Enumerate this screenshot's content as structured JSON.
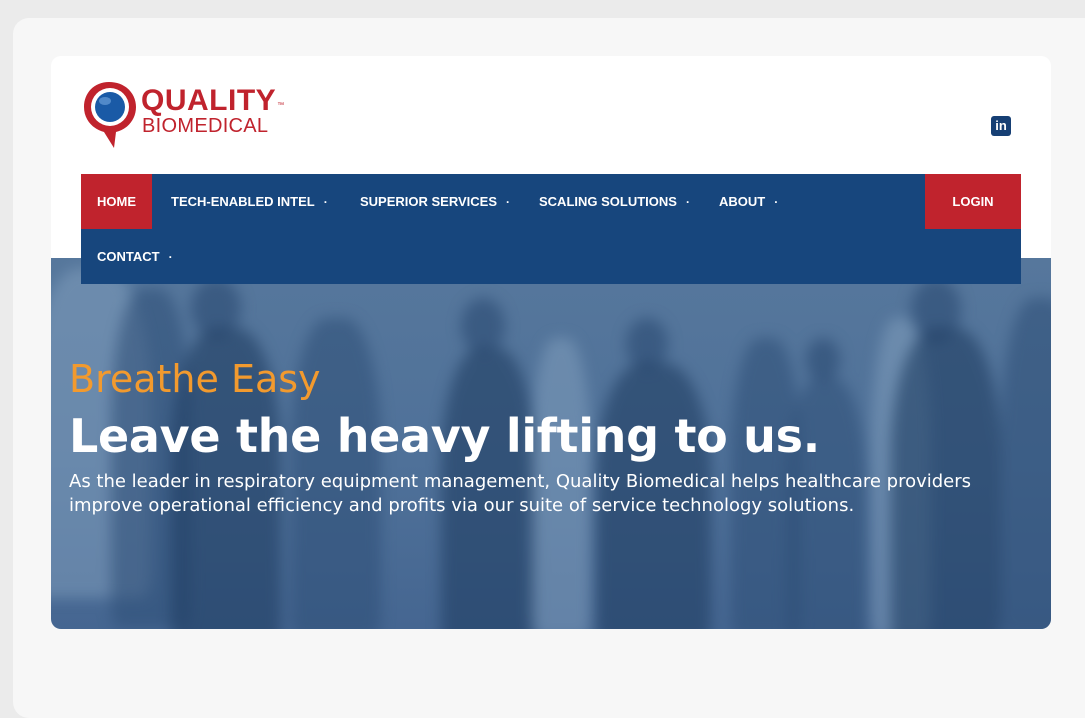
{
  "brand": {
    "name_line1": "QUALITY",
    "name_line2": "BIOMEDICAL",
    "trademark": "™",
    "logo_red": "#c0232d",
    "logo_blue": "#1a5aa6"
  },
  "social": {
    "linkedin_icon": "linkedin-icon",
    "linkedin_label": "in"
  },
  "nav": {
    "items": [
      {
        "label": "HOME",
        "has_dropdown": false,
        "active": true
      },
      {
        "label": "TECH-ENABLED INTEL",
        "has_dropdown": true
      },
      {
        "label": "SUPERIOR SERVICES",
        "has_dropdown": true
      },
      {
        "label": "SCALING SOLUTIONS",
        "has_dropdown": true
      },
      {
        "label": "ABOUT",
        "has_dropdown": true
      },
      {
        "label": "CONTACT",
        "has_dropdown": true
      }
    ],
    "dropdown_glyph": "·",
    "login_label": "LOGIN",
    "bar_color": "#17467d",
    "accent_color": "#c0232d"
  },
  "hero": {
    "tagline": "Breathe Easy",
    "headline": "Leave the heavy lifting to us.",
    "subtext": "As the leader in respiratory equipment management, Quality Biomedical helps healthcare providers improve operational efficiency and profits via our suite of service technology solutions.",
    "tagline_color": "#f29a2e"
  }
}
